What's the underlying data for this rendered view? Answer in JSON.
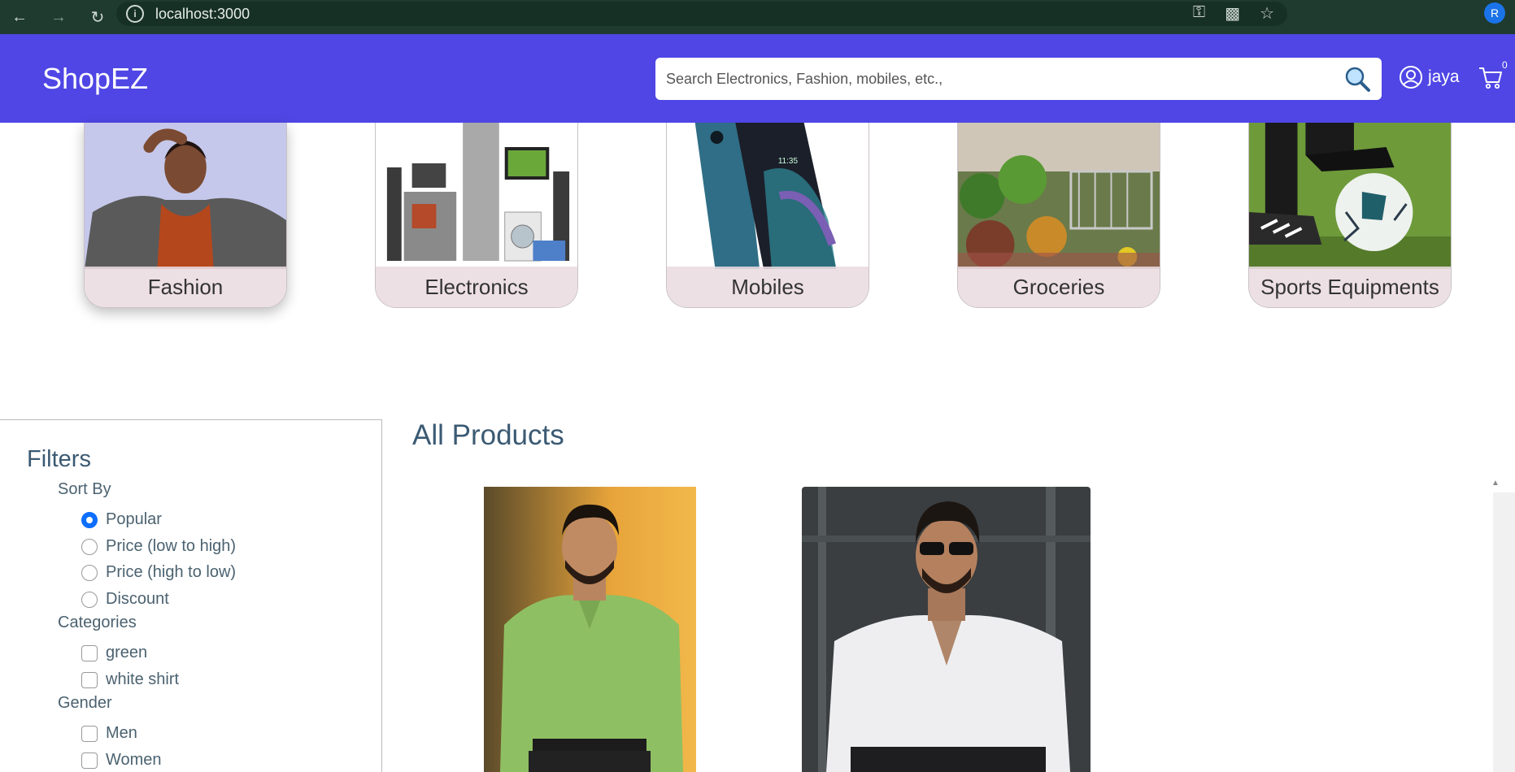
{
  "browser": {
    "url": "localhost:3000",
    "profile_initial": "R"
  },
  "header": {
    "brand": "ShopEZ",
    "search_placeholder": "Search Electronics, Fashion, mobiles, etc.,",
    "username": "jaya",
    "cart_count": "0"
  },
  "categories": [
    {
      "label": "Fashion"
    },
    {
      "label": "Electronics"
    },
    {
      "label": "Mobiles"
    },
    {
      "label": "Groceries"
    },
    {
      "label": "Sports Equipments"
    }
  ],
  "filters": {
    "title": "Filters",
    "sort_by": {
      "label": "Sort By",
      "options": [
        "Popular",
        "Price (low to high)",
        "Price (high to low)",
        "Discount"
      ],
      "selected": "Popular"
    },
    "categories": {
      "label": "Categories",
      "options": [
        "green",
        "white shirt"
      ]
    },
    "gender": {
      "label": "Gender",
      "options": [
        "Men",
        "Women"
      ]
    }
  },
  "products": {
    "title": "All Products"
  },
  "colors": {
    "header_bg": "#4f46e5",
    "accent": "#0d6efd",
    "heading": "#3b5a73"
  }
}
